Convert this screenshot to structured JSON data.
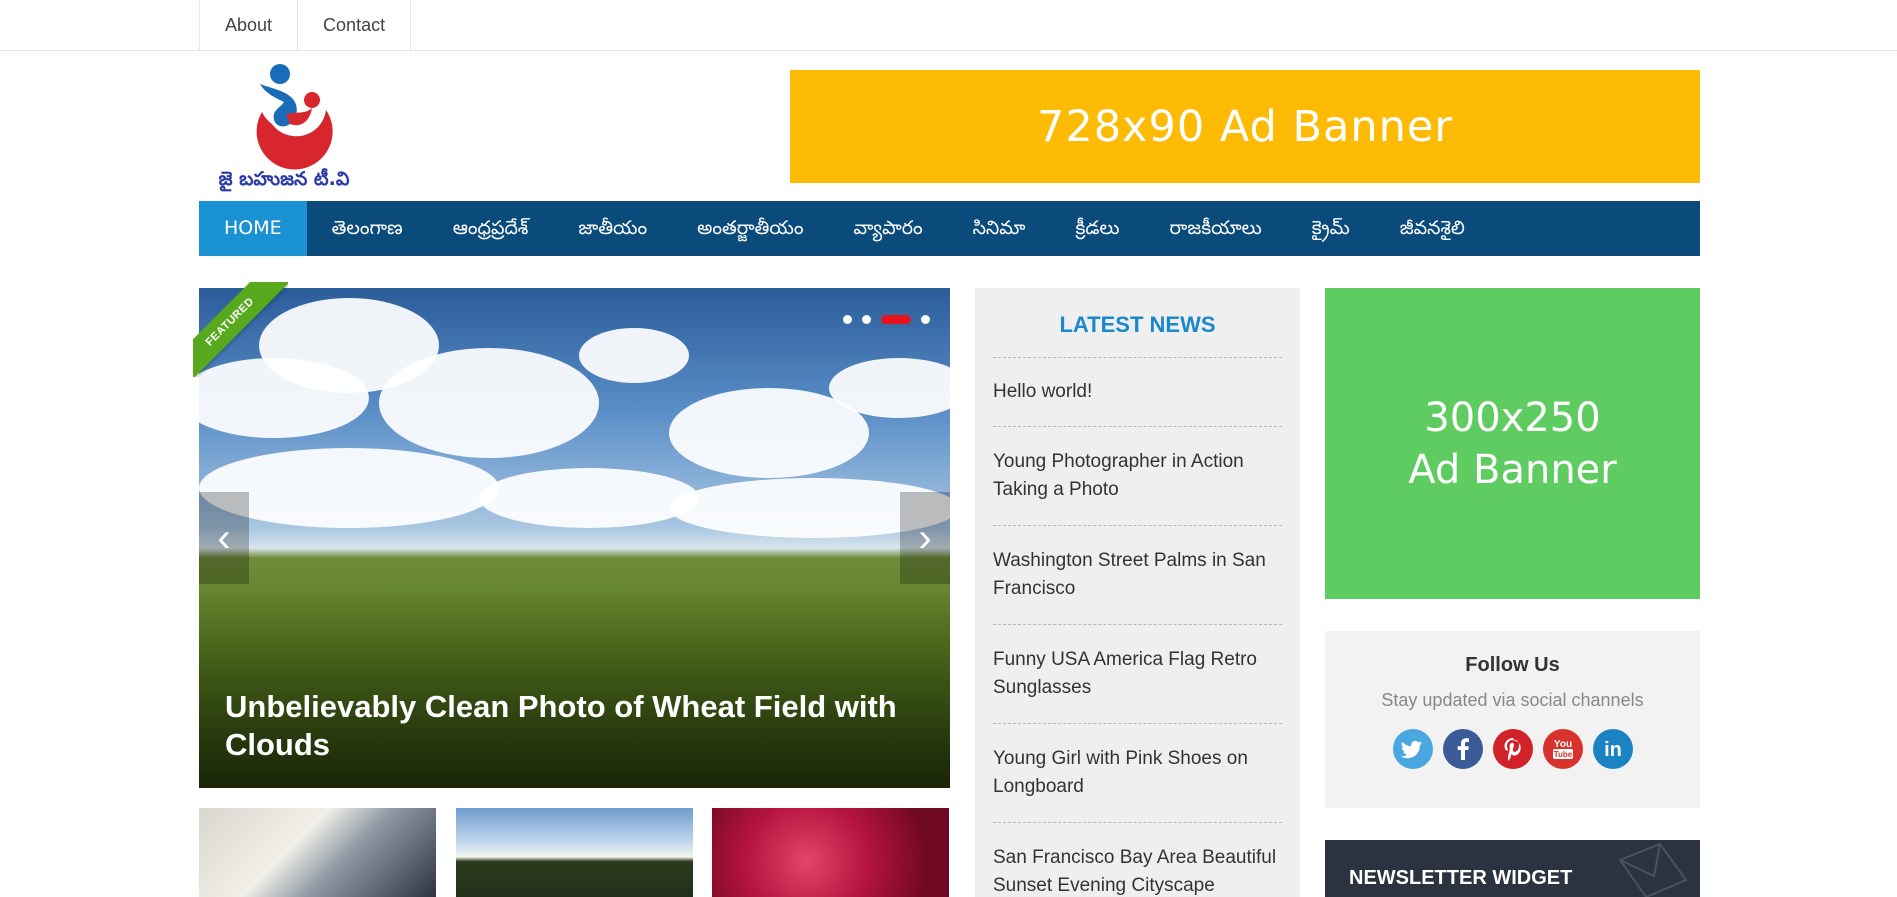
{
  "topbar": {
    "links": [
      "About",
      "Contact"
    ]
  },
  "header": {
    "logo_text": "జై బహుజన టీ.వి",
    "ad_text": "728x90 Ad Banner"
  },
  "nav": {
    "items": [
      "HOME",
      "తెలంగాణ",
      "ఆంధ్రప్రదేశ్",
      "జాతీయం",
      "అంతర్జాతీయం",
      "వ్యాపారం",
      "సినిమా",
      "క్రీడలు",
      "రాజకీయాలు",
      "క్రైమ్",
      "జీవనశైలి"
    ],
    "active": "HOME"
  },
  "slider": {
    "badge": "FEATURED",
    "title": "Unbelievably Clean Photo of Wheat Field with Clouds",
    "active_dot": 3,
    "dot_count": 4
  },
  "latest_news": {
    "title": "LATEST NEWS",
    "items": [
      "Hello world!",
      "Young Photographer in Action Taking a Photo",
      "Washington Street Palms in San Francisco",
      "Funny USA America Flag Retro Sunglasses",
      "Young Girl with Pink Shoes on Longboard",
      "San Francisco Bay Area Beautiful Sunset Evening Cityscape"
    ]
  },
  "sidebar": {
    "ad_line1": "300x250",
    "ad_line2": "Ad Banner",
    "follow_title": "Follow Us",
    "follow_sub": "Stay updated via social channels",
    "social": [
      {
        "name": "twitter-icon",
        "glyph": "t",
        "color": "#4ba7e0"
      },
      {
        "name": "facebook-icon",
        "glyph": "f",
        "color": "#3b5a98"
      },
      {
        "name": "pinterest-icon",
        "glyph": "P",
        "color": "#d12229"
      },
      {
        "name": "youtube-icon",
        "glyph": "You",
        "color": "#d7322c"
      },
      {
        "name": "linkedin-icon",
        "glyph": "in",
        "color": "#1b82c4"
      }
    ],
    "newsletter_title": "NEWSLETTER WIDGET"
  },
  "colors": {
    "nav_bg": "#0b4b7b",
    "nav_active": "#1a92d1",
    "ad_top": "#fdbb06",
    "ad_side": "#5fcc62",
    "accent": "#1a88c9"
  }
}
